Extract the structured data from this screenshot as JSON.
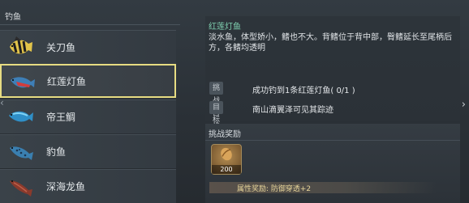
{
  "left": {
    "section_title": "钓鱼",
    "fish": [
      {
        "name": "关刀鱼",
        "icon": "angelfish-icon",
        "selected": false
      },
      {
        "name": "红莲灯鱼",
        "icon": "lantern-fish-icon",
        "selected": true
      },
      {
        "name": "帝王鲷",
        "icon": "bream-icon",
        "selected": false
      },
      {
        "name": "豹鱼",
        "icon": "leopard-fish-icon",
        "selected": false
      },
      {
        "name": "深海龙鱼",
        "icon": "dragonfish-icon",
        "selected": false
      }
    ]
  },
  "detail": {
    "fish_title": "红莲灯鱼",
    "description": "淡水鱼，体型娇小，鳍也不大。背鳍位于背中部，臀鳍延长至尾柄后方，各鳍均透明",
    "challenge_label": "挑战目标",
    "challenge_value": "成功钓到1条红莲灯鱼( 0/1 )",
    "hint_label": "目标提示",
    "hint_value": "南山滴翼泽可见其踪迹"
  },
  "reward": {
    "header": "挑战奖励",
    "item_icon": "seed-icon",
    "item_count": "200",
    "attribute": "属性奖励: 防御穿透+2"
  },
  "colors": {
    "selected_border": "#e7dc82",
    "title_green": "#7fd0b0"
  }
}
